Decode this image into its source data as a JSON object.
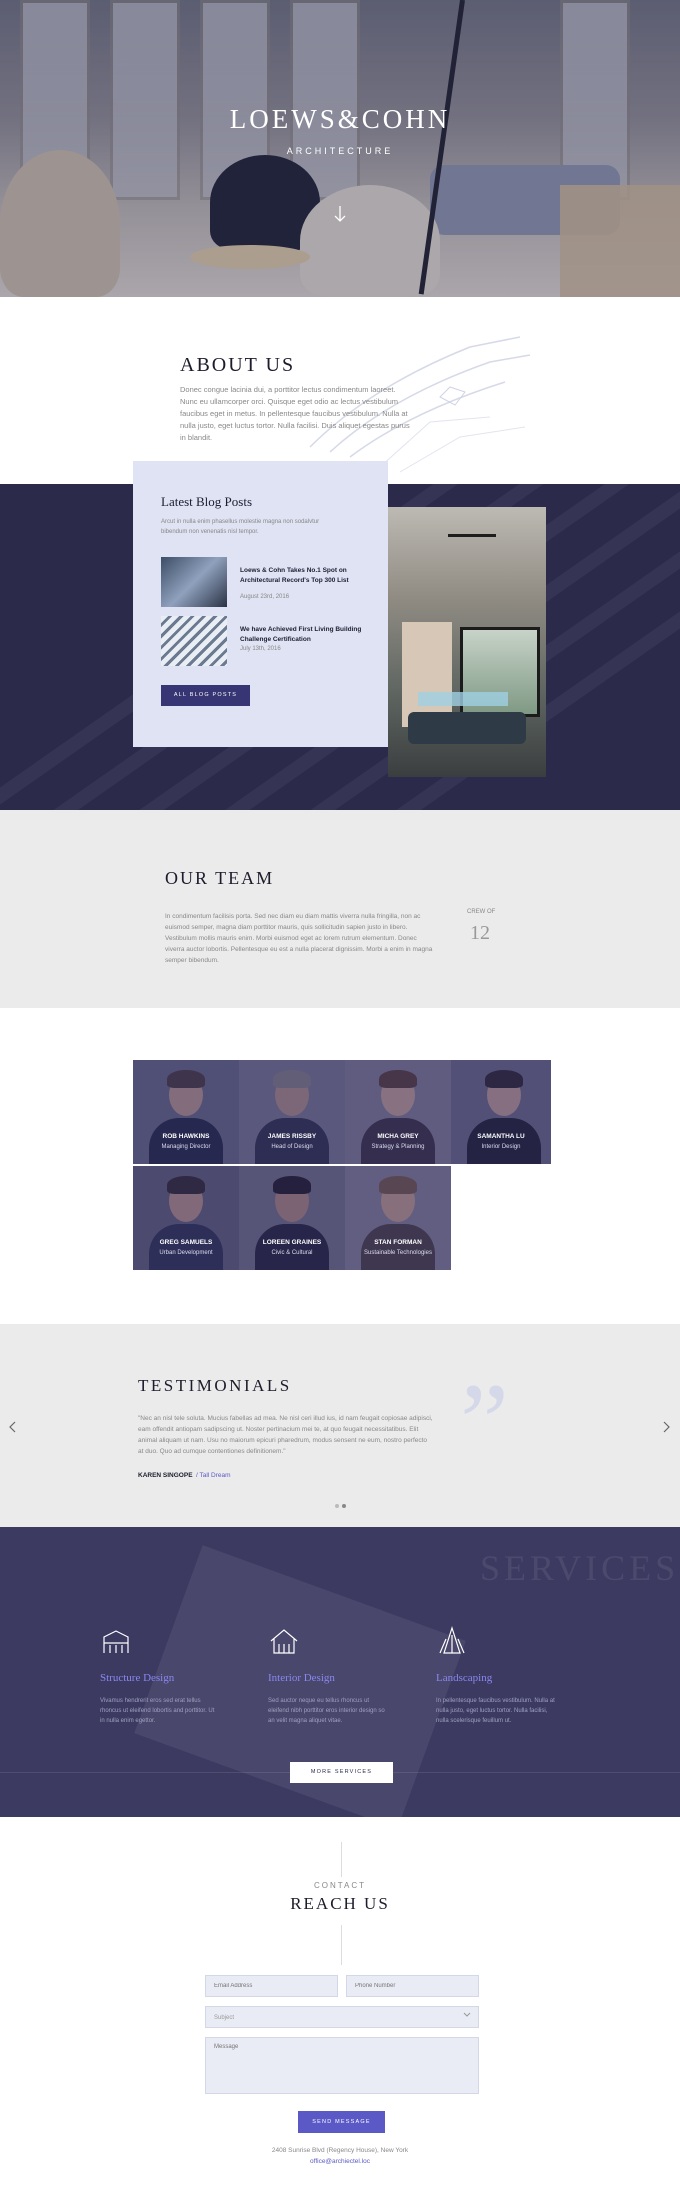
{
  "hero": {
    "brand": "LOEWS&COHN",
    "tagline": "ARCHITECTURE",
    "scroll_icon": "arrow-down-icon"
  },
  "about": {
    "title": "ABOUT US",
    "text": "Donec congue lacinia dui, a porttitor lectus condimentum laoreet. Nunc eu ullamcorper orci. Quisque eget odio ac lectus vestibulum faucibus eget in metus. In pellentesque faucibus vestibulum. Nulla at nulla justo, eget luctus tortor. Nulla facilisi. Duis aliquet egestas purus in blandit."
  },
  "blog": {
    "title": "Latest Blog Posts",
    "intro": "Arcut in nulla enim phasellus molestie magna non sodalvtur bibendum non venenatis nisl tempor.",
    "posts": [
      {
        "title": "Loews & Cohn Takes No.1 Spot on Architectural Record's Top 300 List",
        "date": "August 23rd, 2016"
      },
      {
        "title": "We have Achieved First Living Building Challenge Certification",
        "date": "July 13th, 2016"
      }
    ],
    "button": "ALL BLOG POSTS"
  },
  "team_intro": {
    "title": "OUR TEAM",
    "text": "In condimentum facilisis porta. Sed nec diam eu diam mattis viverra nulla fringilla, non ac euismod semper, magna diam porttitor mauris, quis sollicitudin sapien justo in libero. Vestibulum mollis mauris enim. Morbi euismod eget ac lorem rutrum elementum. Donec viverra auctor lobortis. Pellentesque eu est a nulla placerat dignissim. Morbi a enim in magna semper bibendum.",
    "crew_label": "CREW OF",
    "crew_count": "12"
  },
  "team": [
    {
      "name": "ROB HAWKINS",
      "role": "Managing Director"
    },
    {
      "name": "JAMES RISSBY",
      "role": "Head of Design"
    },
    {
      "name": "MICHA GREY",
      "role": "Strategy & Planning"
    },
    {
      "name": "SAMANTHA LU",
      "role": "Interior Design"
    },
    {
      "name": "GREG SAMUELS",
      "role": "Urban Development"
    },
    {
      "name": "LOREEN GRAINES",
      "role": "Civic & Cultural"
    },
    {
      "name": "STAN FORMAN",
      "role": "Sustainable Technologies"
    }
  ],
  "testimonials": {
    "title": "TESTIMONIALS",
    "quote": "\"Nec an nisl tele soluta. Mucius fabellas ad mea. Ne nisl ceri illud ius, id nam feugait copiosae adipisci, eam offendit antiopam sadipscing ut. Noster pertinacium mei te, at quo feugait necessitatibus. Elit animal aliquam ut nam. Usu no maiorum epicuri pharedrum, modus sensent ne eum, nostro perfecto at duo. Quo ad cumque contentiones definitionem.\"",
    "author": "KAREN SINGOPE",
    "company": "/ Tall Dream",
    "prev_icon": "chevron-left-icon",
    "next_icon": "chevron-right-icon"
  },
  "services": {
    "bg_text": "SERVICES",
    "items": [
      {
        "title": "Structure Design",
        "text": "Vivamus hendrerit eros sed erat tellus rhoncus ut eleifend lobortis and porttitor. Ut in nulla enim egettor.",
        "icon": "building-icon"
      },
      {
        "title": "Interior Design",
        "text": "Sed auctor neque eu tellus rhoncus ut eleifend nibh porttitor eros interior design so an velit magna aliquet vitae.",
        "icon": "house-icon"
      },
      {
        "title": "Landscaping",
        "text": "In pellentesque faucibus vestibulum. Nulla at nulla justo, eget luctus tortor. Nulla facilisi, nulla scelerisque feuillum ut.",
        "icon": "trees-icon"
      }
    ],
    "button": "MORE SERVICES"
  },
  "contact": {
    "label": "CONTACT",
    "title": "REACH US",
    "email_placeholder": "Email Address",
    "phone_placeholder": "Phone Number",
    "subject_placeholder": "Subject",
    "message_placeholder": "Message",
    "button": "SEND MESSAGE",
    "address": "2408 Sunrise Blvd (Regency House), New York",
    "email": "office@archiectel.loc"
  },
  "colors": {
    "navy": "#2b2a4b",
    "accent": "#5b59c6",
    "light_gray": "#ebebeb"
  }
}
